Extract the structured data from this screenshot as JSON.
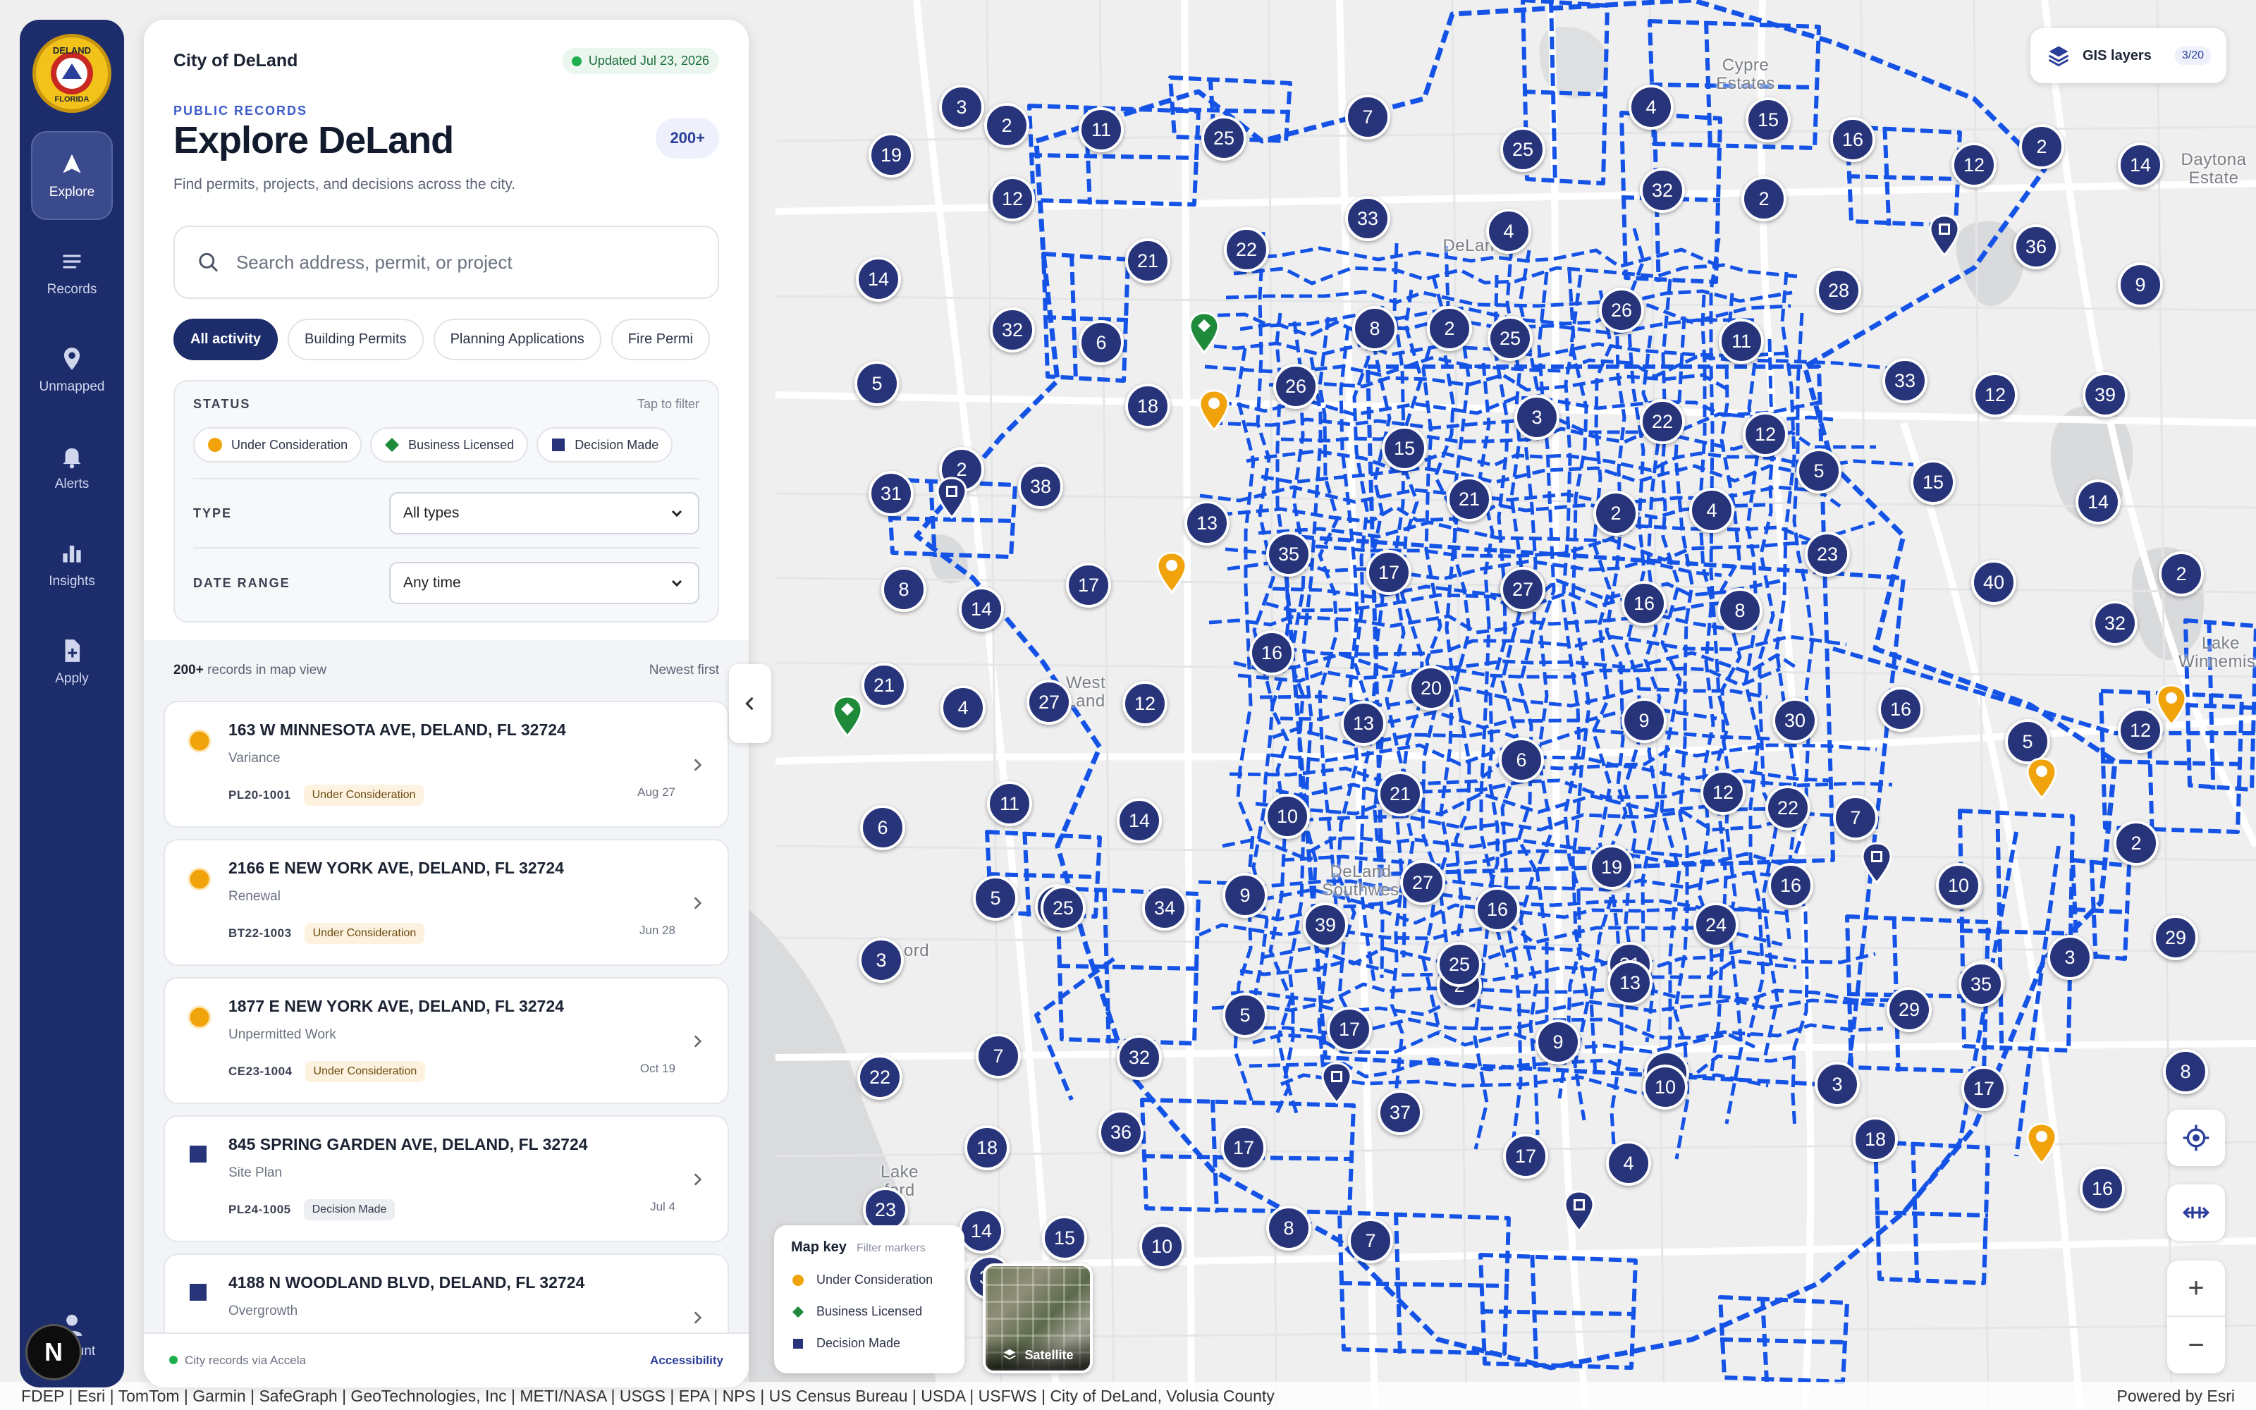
{
  "colors": {
    "rail": "#1d2c6b",
    "cluster": "#27347a",
    "parcel_lines": "#1453e6",
    "under_consideration": "#f0a30a",
    "business_licensed": "#1e8a3a",
    "decision_made": "#27347a"
  },
  "rail": {
    "items": [
      {
        "label": "Explore",
        "icon": "navigation-arrow-icon"
      },
      {
        "label": "Records",
        "icon": "list-icon"
      },
      {
        "label": "Unmapped",
        "icon": "location-pin-icon"
      },
      {
        "label": "Alerts",
        "icon": "bell-icon"
      },
      {
        "label": "Insights",
        "icon": "bar-chart-icon"
      },
      {
        "label": "Apply",
        "icon": "document-add-icon"
      }
    ],
    "account_label": "unt",
    "n_badge": "N"
  },
  "panel": {
    "city": "City of DeLand",
    "updated": "Updated Jul 23, 2026",
    "eyebrow": "PUBLIC RECORDS",
    "title": "Explore DeLand",
    "count": "200+",
    "subtitle": "Find permits, projects, and decisions across the city.",
    "search_placeholder": "Search address, permit, or project",
    "chips": [
      "All activity",
      "Building Permits",
      "Planning Applications",
      "Fire Permi"
    ],
    "filters": {
      "status_label": "STATUS",
      "status_hint": "Tap to filter",
      "statuses": [
        "Under Consideration",
        "Business Licensed",
        "Decision Made"
      ],
      "type_label": "TYPE",
      "type_value": "All types",
      "date_label": "DATE RANGE",
      "date_value": "Any time"
    },
    "list": {
      "count_bold": "200+",
      "count_text": " records in map view",
      "sort": "Newest first",
      "records": [
        {
          "address": "163 W MINNESOTA AVE, DELAND, FL 32724",
          "kind": "Variance",
          "id": "PL20-1001",
          "status": "Under Consideration",
          "date": "Aug 27"
        },
        {
          "address": "2166 E NEW YORK AVE, DELAND, FL 32724",
          "kind": "Renewal",
          "id": "BT22-1003",
          "status": "Under Consideration",
          "date": "Jun 28"
        },
        {
          "address": "1877 E NEW YORK AVE, DELAND, FL 32724",
          "kind": "Unpermitted Work",
          "id": "CE23-1004",
          "status": "Under Consideration",
          "date": "Oct 19"
        },
        {
          "address": "845 SPRING GARDEN AVE, DELAND, FL 32724",
          "kind": "Site Plan",
          "id": "PL24-1005",
          "status": "Decision Made",
          "date": "Jul 4"
        },
        {
          "address": "4188 N WOODLAND BLVD, DELAND, FL 32724",
          "kind": "Overgrowth",
          "id": "",
          "status": "",
          "date": ""
        }
      ]
    },
    "footer": {
      "source": "City records via Accela",
      "link": "Accessibility"
    }
  },
  "map": {
    "gis_label": "GIS layers",
    "gis_count": "3/20",
    "key_title": "Map key",
    "key_hint": "Filter markers",
    "key_items": [
      "Under Consideration",
      "Business Licensed",
      "Decision Made"
    ],
    "satellite_label": "Satellite",
    "attribution": "FDEP | Esri | TomTom | Garmin | SafeGraph | GeoTechnologies, Inc | METI/NASA | USGS | EPA | NPS | US Census Bureau | USDA | USFWS | City of DeLand, Volusia County",
    "powered": "Powered by Esri",
    "place_labels": [
      {
        "text": "Cypre\nEstates"
      },
      {
        "text": "Daytona\nEstate"
      },
      {
        "text": "DeLand"
      },
      {
        "text": "West\nLand"
      },
      {
        "text": "DeLand\nSouthwes"
      },
      {
        "text": "ord"
      },
      {
        "text": "Lake\nford"
      },
      {
        "text": "Lake\nWinnemisset"
      }
    ],
    "clusters": [
      3,
      2,
      11,
      25,
      7,
      25,
      4,
      15,
      16,
      2,
      12,
      14,
      19,
      12,
      33,
      32,
      2,
      22,
      21,
      4,
      36,
      14,
      28,
      9,
      32,
      6,
      8,
      2,
      25,
      26,
      11,
      5,
      18,
      26,
      3,
      22,
      12,
      5,
      33,
      12,
      39,
      31,
      2,
      38,
      15,
      13,
      35,
      21,
      2,
      4,
      15,
      14,
      8,
      14,
      17,
      3,
      27,
      16,
      8,
      23,
      40,
      2,
      32,
      17,
      16,
      20,
      21,
      4,
      27,
      12,
      13,
      9,
      30,
      16,
      5,
      12,
      6,
      11,
      14,
      10,
      21,
      6,
      12,
      9,
      24,
      22,
      7,
      44,
      2,
      5,
      25,
      34,
      9,
      27,
      16,
      19,
      16,
      10,
      3,
      39,
      2,
      31,
      3,
      29,
      13,
      25,
      21,
      29,
      3,
      7,
      32,
      17,
      9,
      32,
      22,
      5,
      35,
      8,
      17,
      10,
      37,
      36,
      17,
      18,
      17,
      33,
      4,
      18,
      16,
      23,
      14,
      15,
      10,
      8,
      7
    ]
  }
}
